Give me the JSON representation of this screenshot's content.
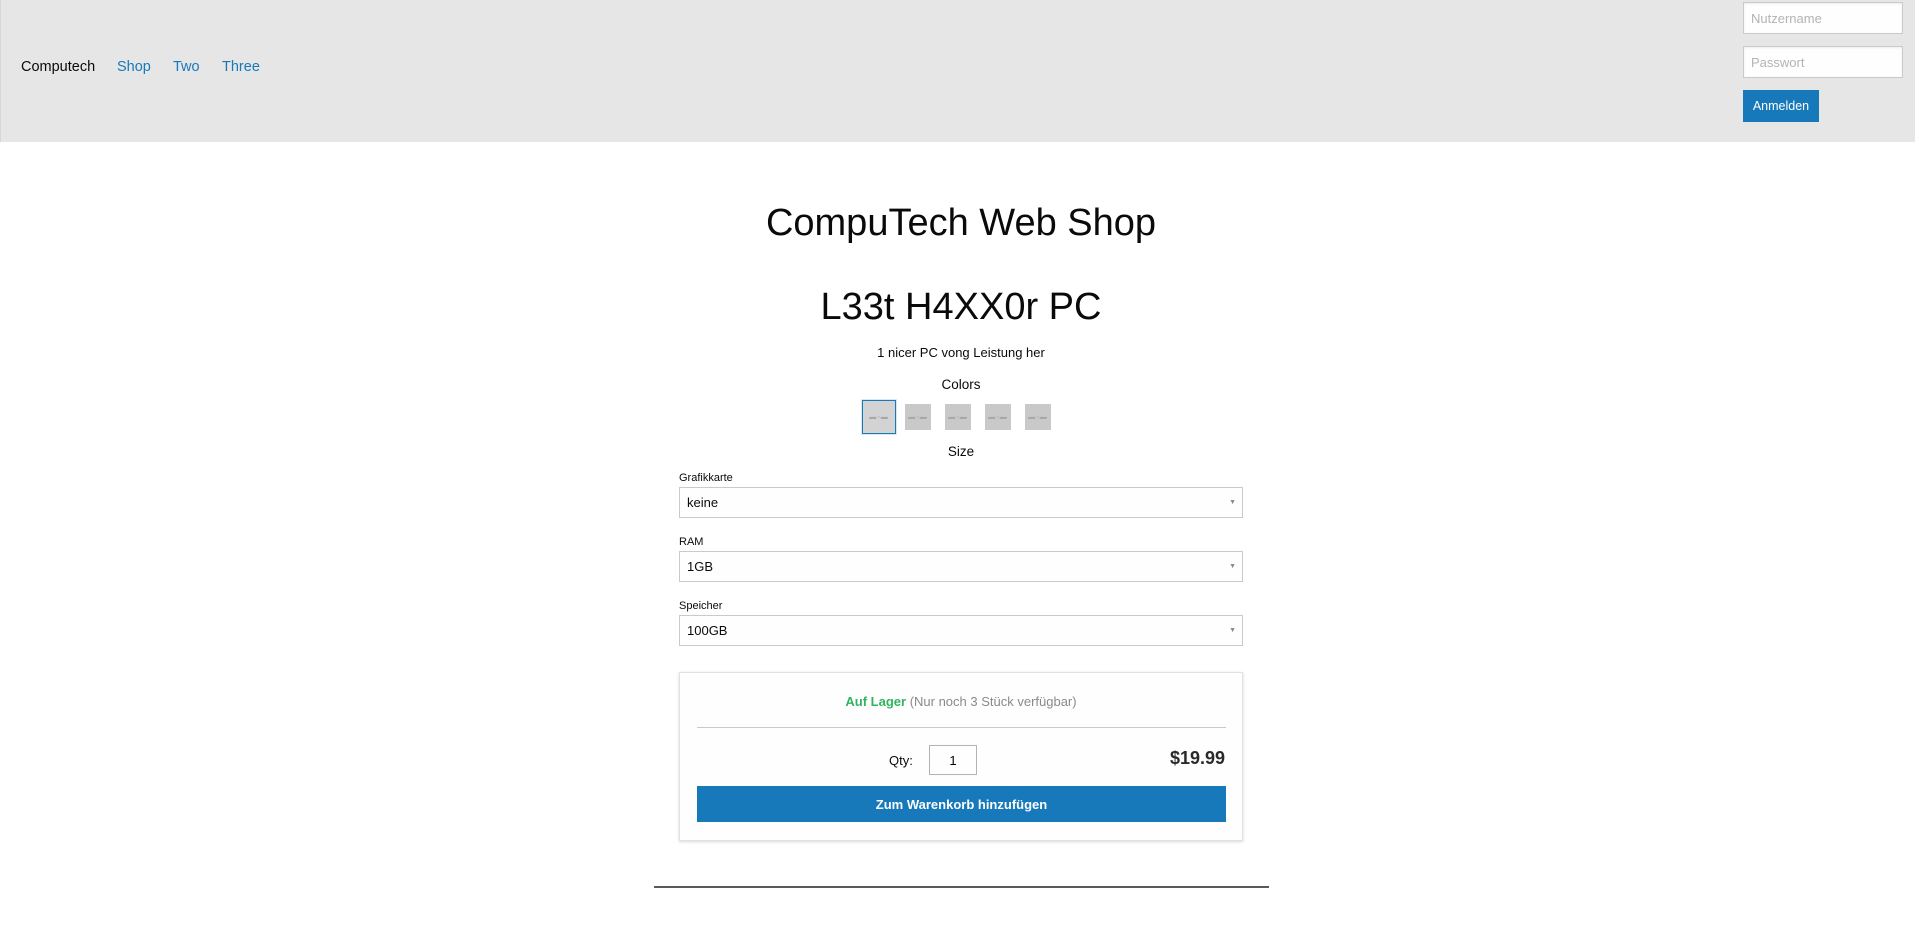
{
  "nav": {
    "brand": "Computech",
    "links": [
      "Shop",
      "Two",
      "Three"
    ]
  },
  "login": {
    "username_placeholder": "Nutzername",
    "password_placeholder": "Passwort",
    "submit_label": "Anmelden"
  },
  "main": {
    "shop_title": "CompuTech Web Shop",
    "product_title": "L33t H4XX0r PC",
    "product_description": "1 nicer PC vong Leistung her",
    "colors_label": "Colors",
    "size_label": "Size",
    "color_swatches": [
      {
        "selected": true
      },
      {
        "selected": false
      },
      {
        "selected": false
      },
      {
        "selected": false
      },
      {
        "selected": false
      }
    ]
  },
  "options": [
    {
      "label": "Grafikkarte",
      "value": "keine"
    },
    {
      "label": "RAM",
      "value": "1GB"
    },
    {
      "label": "Speicher",
      "value": "100GB"
    }
  ],
  "purchase": {
    "stock_status": "Auf Lager",
    "stock_note": "(Nur noch 3 Stück verfügbar)",
    "qty_label": "Qty:",
    "qty_value": "1",
    "price": "$19.99",
    "add_to_cart_label": "Zum Warenkorb hinzufügen"
  },
  "colors": {
    "accent": "#1779ba",
    "topbar_bg": "#e6e6e6",
    "in_stock": "#2fb55f"
  }
}
